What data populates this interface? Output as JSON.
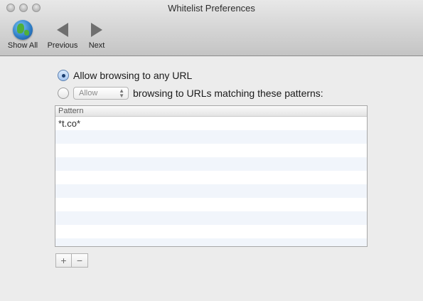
{
  "window": {
    "title": "Whitelist Preferences"
  },
  "toolbar": {
    "show_all_label": "Show All",
    "previous_label": "Previous",
    "next_label": "Next"
  },
  "options": {
    "any_url_label": "Allow browsing to any URL",
    "pattern_select_value": "Allow",
    "pattern_suffix_label": "browsing to URLs matching these patterns:",
    "selected": "any_url"
  },
  "patterns_table": {
    "column_header": "Pattern",
    "rows": [
      "*t.co*",
      "",
      "",
      "",
      "",
      "",
      "",
      "",
      "",
      ""
    ]
  },
  "list_buttons": {
    "add_label": "+",
    "remove_label": "−"
  },
  "icons": {
    "show_all": "globe-icon",
    "previous": "left-arrow-icon",
    "next": "right-arrow-icon",
    "select_caret": "updown-caret-icon"
  },
  "colors": {
    "accent": "#5a7fb0",
    "row_alt": "#f1f5fb"
  }
}
